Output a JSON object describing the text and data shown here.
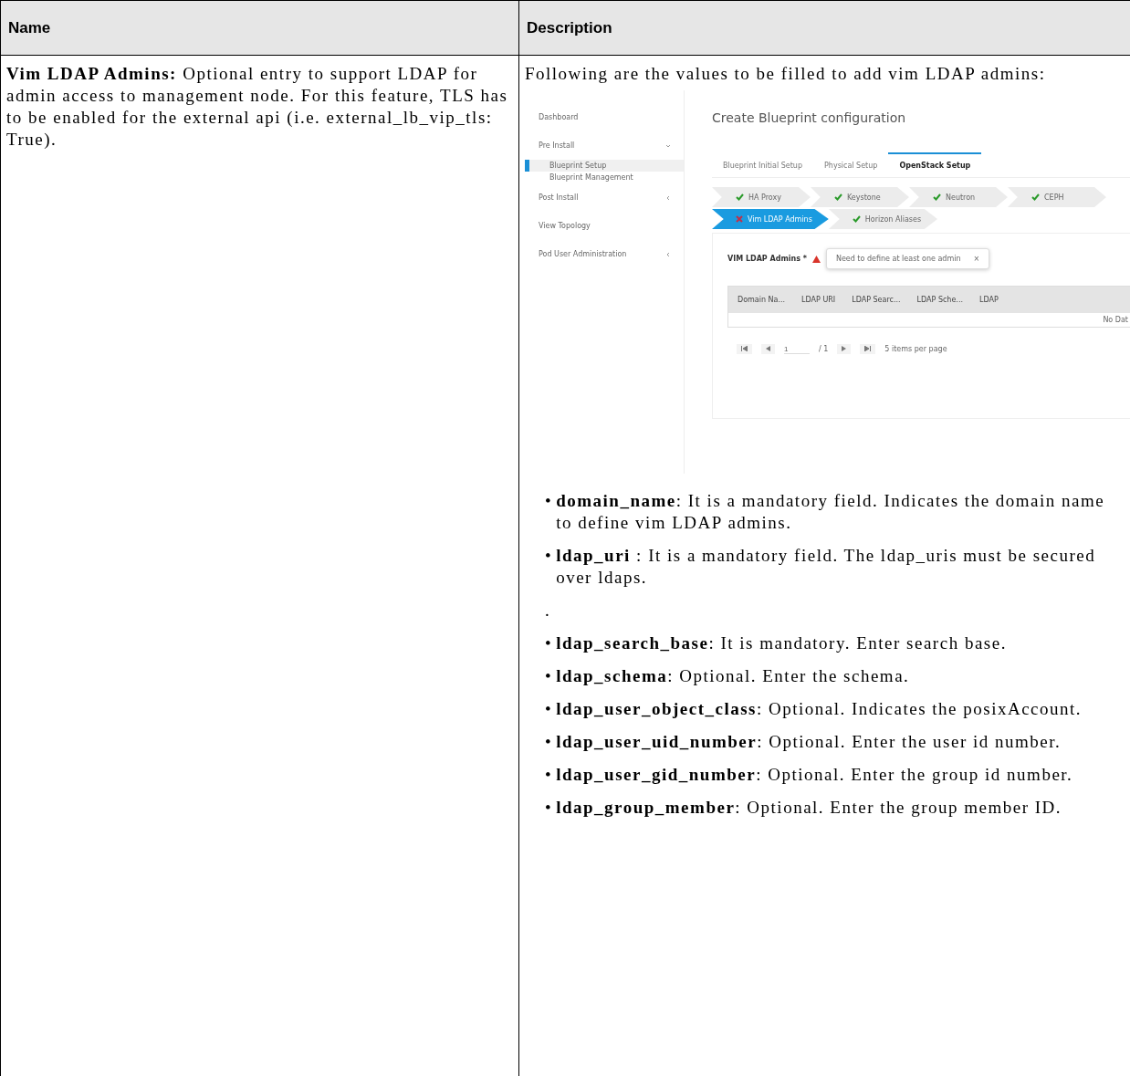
{
  "table": {
    "columns": [
      "Name",
      "Description"
    ],
    "rows": [
      {
        "name": {
          "term": "Vim LDAP Admins:",
          "text": "Optional entry to support LDAP for admin access to management node. For this feature, TLS has to be enabled for the external api (i.e. external_lb_vip_tls: True)."
        },
        "description": {
          "intro": "Following are the values to be filled to add vim LDAP admins:",
          "screenshot": {
            "sidebar": [
              {
                "label": "Dashboard"
              },
              {
                "label": "Pre Install",
                "expanded": true,
                "children": [
                  {
                    "label": "Blueprint Setup",
                    "selected": true
                  },
                  {
                    "label": "Blueprint Management",
                    "selected": false
                  }
                ]
              },
              {
                "label": "Post Install",
                "expanded": false
              },
              {
                "label": "View Topology"
              },
              {
                "label": "Pod User Administration",
                "expanded": false
              }
            ],
            "title": "Create Blueprint configuration",
            "tabs": [
              {
                "label": "Blueprint Initial Setup",
                "selected": false
              },
              {
                "label": "Physical Setup",
                "selected": false
              },
              {
                "label": "OpenStack Setup",
                "selected": true
              }
            ],
            "steps": [
              {
                "label": "HA Proxy",
                "valid": true,
                "selected": false
              },
              {
                "label": "Keystone",
                "valid": true,
                "selected": false
              },
              {
                "label": "Neutron",
                "valid": true,
                "selected": false
              },
              {
                "label": "CEPH",
                "valid": true,
                "selected": false
              },
              {
                "label": "Vim LDAP Admins",
                "valid": false,
                "selected": true
              },
              {
                "label": "Horizon Aliases",
                "valid": true,
                "selected": false
              }
            ],
            "field_label": "VIM LDAP Admins *",
            "tooltip": {
              "text": "Need to define at least one admin",
              "close": "×"
            },
            "grid": {
              "columns": [
                "Domain Na...",
                "LDAP URI",
                "LDAP Searc...",
                "LDAP Sche...",
                "LDAP"
              ],
              "empty": "No Dat"
            },
            "pager": {
              "page": "1",
              "total": "/ 1",
              "per_page": "5 items per page"
            }
          },
          "items": [
            {
              "kind": "bullet",
              "bullet": "•",
              "term": "domain_name",
              "text": ": It is a mandatory field. Indicates the domain name to define vim LDAP admins."
            },
            {
              "kind": "bullet",
              "bullet": "•",
              "term": "ldap_uri",
              "text": " : It is a mandatory field. The ldap_uris must be secured over ldaps."
            },
            {
              "kind": "note",
              "text": "."
            },
            {
              "kind": "bullet",
              "bullet": "•",
              "term": "ldap_search_base",
              "text": ": It is mandatory. Enter search base."
            },
            {
              "kind": "bullet",
              "bullet": "•",
              "term": "ldap_schema",
              "text": ": Optional. Enter the schema."
            },
            {
              "kind": "bullet",
              "bullet": "•",
              "term": "ldap_user_object_class",
              "text": ": Optional. Indicates the posixAccount."
            },
            {
              "kind": "bullet",
              "bullet": "•",
              "term": "ldap_user_uid_number",
              "text": ": Optional. Enter the user id number."
            },
            {
              "kind": "bullet",
              "bullet": "•",
              "term": "ldap_user_gid_number",
              "text": ": Optional. Enter the group id number."
            },
            {
              "kind": "bullet",
              "bullet": "•",
              "term": "ldap_group_member",
              "text": ": Optional. Enter the group member ID."
            }
          ]
        }
      }
    ]
  }
}
